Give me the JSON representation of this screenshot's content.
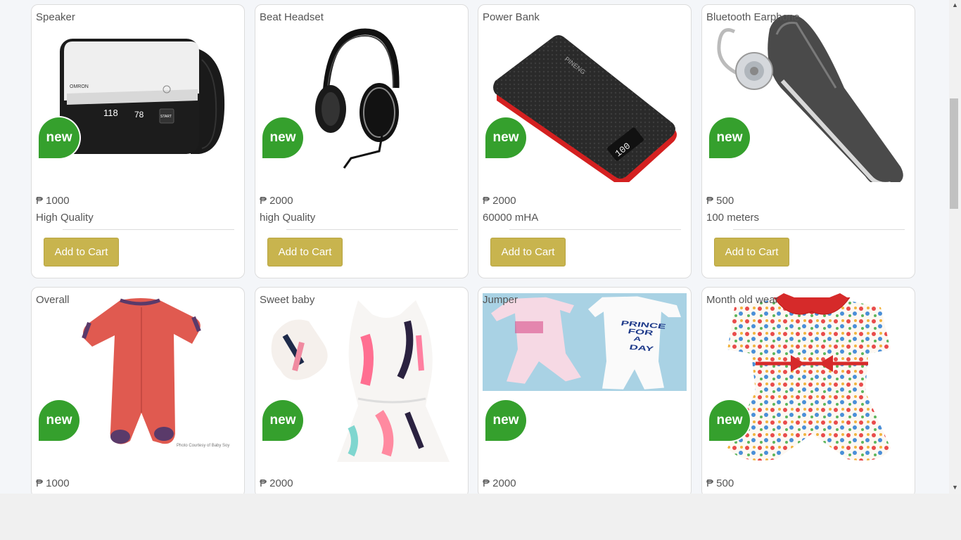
{
  "currency": "₱",
  "badge_label": "new",
  "cart_label": "Add to Cart",
  "products": [
    {
      "name": "Speaker",
      "price": "₱ 1000",
      "desc": "High Quality",
      "icon": "blood-pressure-monitor-image"
    },
    {
      "name": "Beat Headset",
      "price": "₱ 2000",
      "desc": "high Quality",
      "icon": "headphones-image"
    },
    {
      "name": "Power Bank",
      "price": "₱ 2000",
      "desc": "60000 mHA",
      "icon": "power-bank-image"
    },
    {
      "name": "Bluetooth Earphone",
      "price": "₱ 500",
      "desc": "100 meters",
      "icon": "bluetooth-earpiece-image"
    },
    {
      "name": "Overall",
      "price": "₱ 1000",
      "desc": "",
      "icon": "red-baby-onesie-image"
    },
    {
      "name": "Sweet baby",
      "price": "₱ 2000",
      "desc": "",
      "icon": "feather-romper-image"
    },
    {
      "name": "Jumper",
      "price": "₱ 2000",
      "desc": "",
      "icon": "baby-jumpers-image"
    },
    {
      "name": "Month old wear",
      "price": "₱ 500",
      "desc": "",
      "icon": "floral-romper-image"
    }
  ],
  "image_text": {
    "monitor_brand": "OMRON",
    "monitor_sys": "118",
    "monitor_pulse": "78",
    "monitor_start": "START",
    "powerbank_display": "100",
    "powerbank_brand": "PINENG",
    "jumper_text": [
      "PRINCE",
      "FOR",
      "A",
      "DAY"
    ],
    "photo_credit": "Photo Courtesy of Baby Soy"
  },
  "colors": {
    "badge": "#35a02d",
    "button": "#c8b44e",
    "page_bg": "#f4f6f9"
  }
}
